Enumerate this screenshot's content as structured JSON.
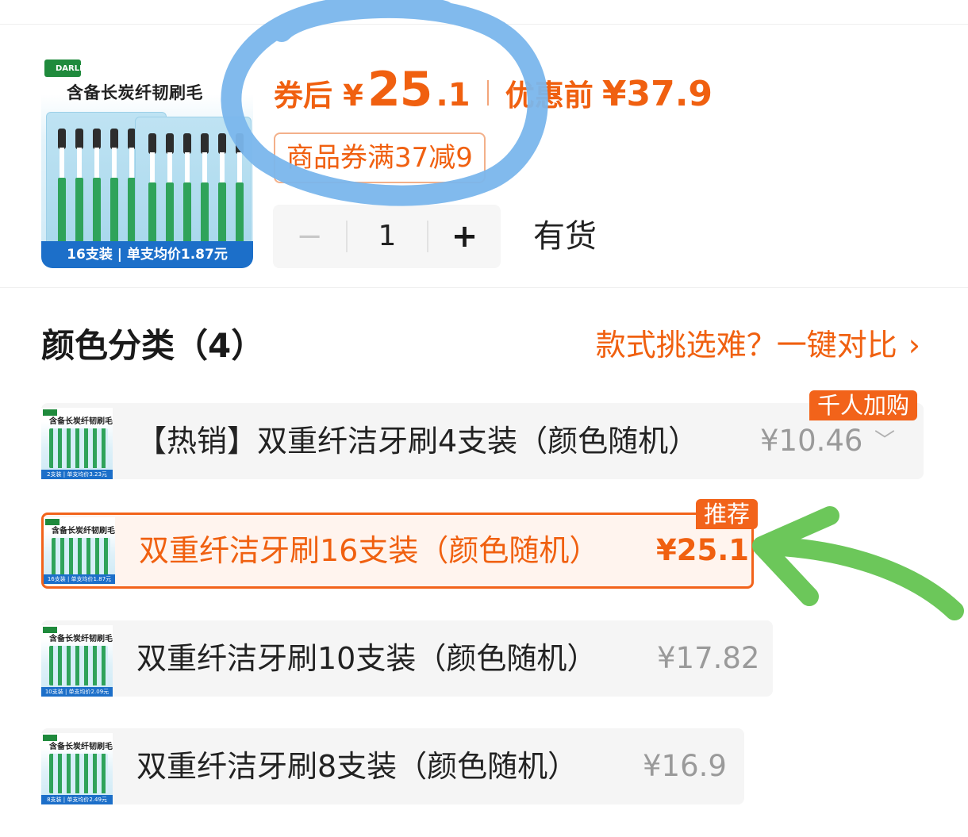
{
  "product": {
    "image": {
      "brand_logo": "DARLIE 好来",
      "headline": "含备长炭纤韧刷毛",
      "bottom_text": "16支装 | 单支均价1.87元"
    },
    "price": {
      "after_label": "券后",
      "currency": "¥",
      "after_int": "25",
      "after_dec": ".1",
      "before_label": "优惠前",
      "before_price": "¥37.9"
    },
    "coupon": "商品券满37减9",
    "quantity": {
      "minus": "−",
      "value": "1",
      "plus": "+"
    },
    "stock": "有货"
  },
  "color_section": {
    "title": "颜色分类（4）",
    "compare_link": "款式挑选难？一键对比",
    "compare_chevron": "›"
  },
  "options": [
    {
      "name": "【热销】双重纤洁牙刷4支装（颜色随机）",
      "price": "¥10.46",
      "badge": "千人加购",
      "thumb_head": "含备长炭纤韧刷毛",
      "thumb_bar": "2支装 | 单支均价3.23元",
      "selected": false
    },
    {
      "name": "双重纤洁牙刷16支装（颜色随机）",
      "price": "¥25.1",
      "badge": "推荐",
      "thumb_head": "含备长炭纤韧刷毛",
      "thumb_bar": "16支装 | 单支均价1.87元",
      "selected": true
    },
    {
      "name": "双重纤洁牙刷10支装（颜色随机）",
      "price": "¥17.82",
      "thumb_head": "含备长炭纤韧刷毛",
      "thumb_bar": "10支装 | 单支均价2.09元",
      "selected": false
    },
    {
      "name": "双重纤洁牙刷8支装（颜色随机）",
      "price": "¥16.9",
      "thumb_head": "含备长炭纤韧刷毛",
      "thumb_bar": "8支装 | 单支均价2.49元",
      "selected": false
    }
  ],
  "colors": {
    "accent": "#f06010",
    "annotation_circle": "#7ab6ec",
    "annotation_arrow": "#6cc75a"
  }
}
